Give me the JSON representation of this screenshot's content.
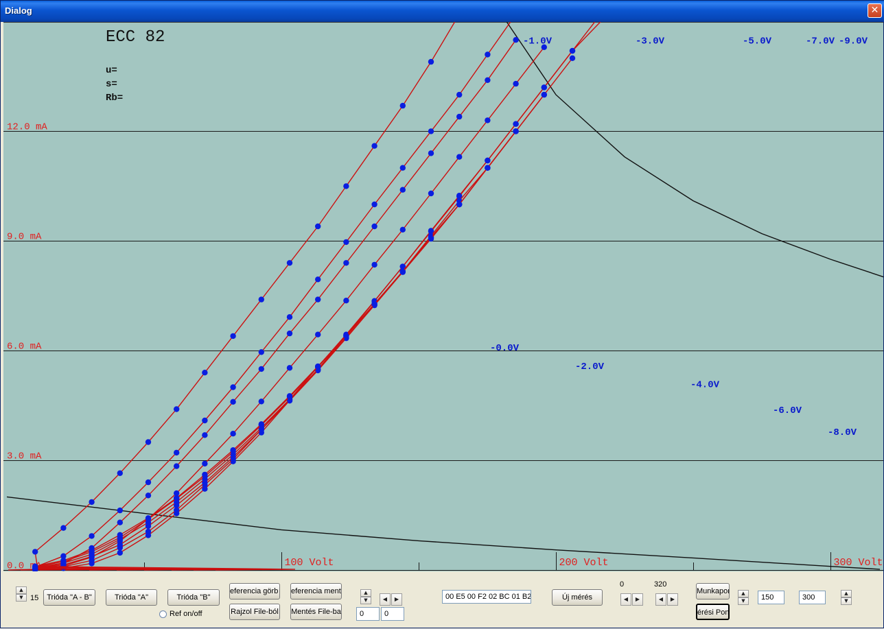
{
  "window": {
    "title": "Dialog",
    "close_glyph": "✕"
  },
  "chart_data": {
    "type": "line",
    "title": "ECC 82",
    "params": [
      "u=",
      "s=",
      "Rb="
    ],
    "xlabel": "",
    "ylabel": "",
    "x_tick_labels": [
      {
        "value": 100,
        "label": "100 Volt"
      },
      {
        "value": 200,
        "label": "200 Volt"
      },
      {
        "value": 300,
        "label": "300 Volt"
      }
    ],
    "y_tick_labels": [
      {
        "value": 0,
        "label": "0.0 mA"
      },
      {
        "value": 3,
        "label": "3.0 mA"
      },
      {
        "value": 6,
        "label": "6.0 mA"
      },
      {
        "value": 9,
        "label": "9.0 mA"
      },
      {
        "value": 12,
        "label": "12.0 mA"
      }
    ],
    "xlim": [
      0,
      318
    ],
    "ylim": [
      0,
      15
    ],
    "grid": "horizontal",
    "colors": {
      "background": "#a3c6c1",
      "curve": "#cc1111",
      "point": "#0a1ee0",
      "y_label": "#e02020",
      "x_label": "#e02020",
      "series_label": "#0a1acc",
      "load_line": "#111111"
    },
    "x_points": [
      10.3,
      20.6,
      30.9,
      41.2,
      51.5,
      61.8,
      72.1,
      82.4,
      92.7,
      103,
      113.3,
      123.6,
      133.9,
      144.2,
      154.5,
      164.8,
      175.1,
      185.4,
      195.7,
      206,
      216.3,
      226.6,
      236.9,
      247.2,
      257.5,
      267.8,
      278.1,
      288.4,
      298.7,
      309
    ],
    "series": [
      {
        "name": "-0.0V",
        "label_at": [
          176,
          6.0
        ],
        "values": [
          0.5,
          1.15,
          1.86,
          2.65,
          3.5,
          4.4,
          5.4,
          6.4,
          7.4,
          8.4,
          9.4,
          10.5,
          11.6,
          12.7,
          13.9,
          15.2
        ]
      },
      {
        "name": "-1.0V",
        "label_at": [
          188,
          14.4
        ],
        "values": [
          0.08,
          0.38,
          0.93,
          1.63,
          2.4,
          3.21,
          4.09,
          5.0,
          5.96,
          6.92,
          7.95,
          8.97,
          10.0,
          11.0,
          12.0,
          13.0,
          14.1,
          15.2
        ]
      },
      {
        "name": "-2.0V",
        "label_at": [
          207,
          5.5
        ],
        "values": [
          0.03,
          0.18,
          0.6,
          1.3,
          2.04,
          2.84,
          3.69,
          4.6,
          5.5,
          6.47,
          7.4,
          8.4,
          9.4,
          10.4,
          11.4,
          12.4,
          13.4,
          14.5,
          15.5
        ]
      },
      {
        "name": "-3.0V",
        "label_at": [
          229,
          14.4
        ],
        "values": [
          0.02,
          0.11,
          0.35,
          0.79,
          1.4,
          2.1,
          2.91,
          3.73,
          4.61,
          5.53,
          6.44,
          7.37,
          8.35,
          9.31,
          10.3,
          11.3,
          12.3,
          13.3,
          14.3,
          15.4
        ]
      },
      {
        "name": "-4.0V",
        "label_at": [
          249,
          5.0
        ],
        "values": [
          0.01,
          0.05,
          0.18,
          0.47,
          0.95,
          1.55,
          2.22,
          2.97,
          3.76,
          4.64,
          5.49,
          6.41,
          7.35,
          8.3,
          9.28,
          10.24,
          11.2,
          12.2,
          13.2,
          14.2,
          15.2
        ]
      },
      {
        "name": "-5.0V",
        "label_at": [
          268,
          14.4
        ],
        "values": [
          0.02,
          0.09,
          0.26,
          0.61,
          1.05,
          1.64,
          2.33,
          3.03,
          3.84,
          4.66,
          5.56,
          6.44,
          7.36,
          8.3,
          9.26,
          10.22,
          11.2,
          12.2,
          13.2,
          14.2,
          15.0
        ]
      },
      {
        "name": "-6.0V",
        "label_at": [
          279,
          4.3
        ],
        "values": [
          0.04,
          0.14,
          0.37,
          0.69,
          1.2,
          1.77,
          2.39,
          3.09,
          3.84,
          4.63,
          5.46,
          6.34,
          7.25,
          8.17,
          9.14,
          10.1,
          11.0,
          12.0,
          13.0,
          14.0
        ]
      },
      {
        "name": "-7.0V",
        "label_at": [
          291,
          14.4
        ],
        "values": [
          0.07,
          0.19,
          0.43,
          0.84,
          1.3,
          1.86,
          2.49,
          3.16,
          3.89,
          4.67,
          5.49,
          6.36,
          7.24,
          8.15,
          9.1,
          10.0,
          11.0,
          12.0,
          13.0
        ]
      },
      {
        "name": "-8.0V",
        "label_at": [
          299,
          3.7
        ],
        "values": [
          0.08,
          0.23,
          0.5,
          0.89,
          1.39,
          1.95,
          2.56,
          3.23,
          3.96,
          4.73,
          5.55,
          6.4,
          7.28,
          8.17,
          9.1,
          10.0,
          11.0,
          12.0
        ]
      },
      {
        "name": "-9.0V",
        "label_at": [
          303,
          14.4
        ],
        "values": [
          0.1,
          0.26,
          0.54,
          0.96,
          1.42,
          1.97,
          2.61,
          3.28,
          3.99,
          4.76,
          5.57,
          6.41,
          7.28,
          8.15,
          9.06,
          10.0,
          11.0,
          12.0
        ]
      }
    ],
    "curves_start_x": [
      [
        0.5,
        11.2
      ],
      [
        5,
        21.5
      ],
      [
        12,
        32
      ],
      [
        20,
        43
      ],
      [
        30,
        53
      ],
      [
        40,
        64
      ],
      [
        50,
        74
      ],
      [
        60,
        85
      ],
      [
        68,
        95
      ],
      [
        76,
        105
      ]
    ],
    "load_lines": [
      {
        "x": [
          0,
          50,
          100,
          150,
          200,
          250,
          300,
          318
        ],
        "y": [
          2.0,
          1.55,
          1.1,
          0.8,
          0.55,
          0.33,
          0.1,
          0.02
        ]
      },
      {
        "x": [
          182,
          200,
          225,
          250,
          275,
          300,
          320
        ],
        "y": [
          15.0,
          13.0,
          11.3,
          10.1,
          9.2,
          8.5,
          8.0
        ]
      }
    ]
  },
  "controls": {
    "spin_count_value": "15",
    "btn_trioda_ab": "Trióda \"A - B\"",
    "btn_trioda_a": "Trióda  \"A\"",
    "btn_trioda_b": "Trióda  \"B\"",
    "btn_referencia_gorbe": "eferencia görb",
    "btn_rajzol_file": "Rajzol File-ból",
    "btn_referencia_mentes": "eferencia ment",
    "btn_mentes_file": "Mentés File-ba",
    "radio_ref_label": "Ref on/off",
    "field_left": "0",
    "field_right": "0",
    "hex_field": "00 E5 00 F2 02 BC 01 B2",
    "btn_uj_meres": "Új mérés",
    "range_min_label": "0",
    "range_max_label": "320",
    "btn_munkapont": "Munkapon",
    "btn_meresi_pont": "érési Pont",
    "field_150": "150",
    "field_300": "300"
  }
}
